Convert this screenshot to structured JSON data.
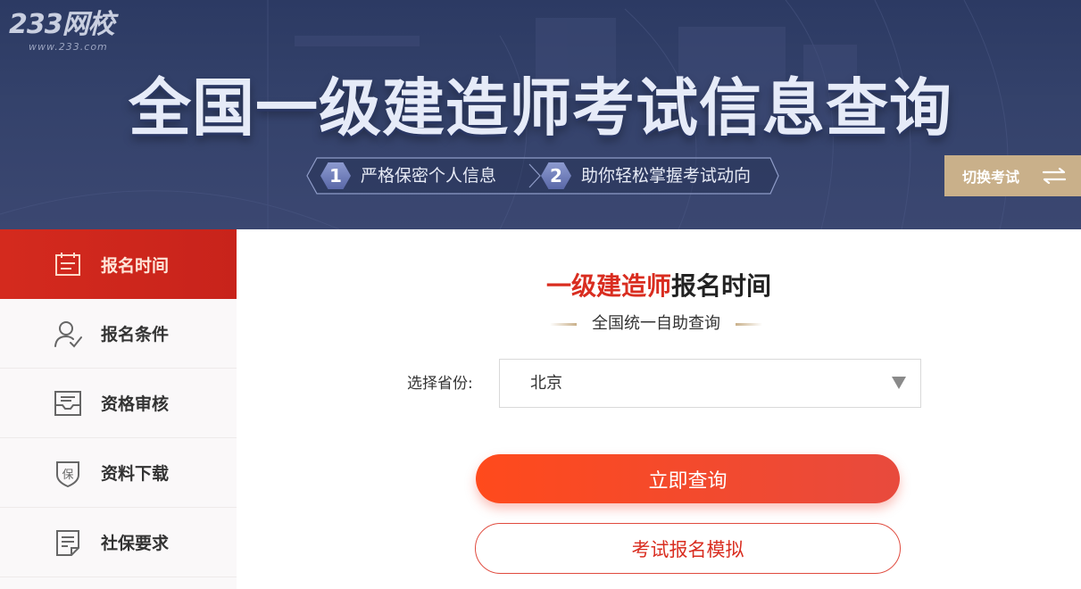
{
  "brand": {
    "logo_text": "233网校",
    "logo_url_text": "www.233.com"
  },
  "banner": {
    "title": "全国一级建造师考试信息查询",
    "tips": [
      {
        "num": "1",
        "text": "严格保密个人信息"
      },
      {
        "num": "2",
        "text": "助你轻松掌握考试动向"
      }
    ],
    "switch_label": "切换考试",
    "switch_icon": "swap-arrows-icon"
  },
  "sidebar": {
    "items": [
      {
        "label": "报名时间",
        "icon": "calendar-icon",
        "active": true
      },
      {
        "label": "报名条件",
        "icon": "user-check-icon",
        "active": false
      },
      {
        "label": "资格审核",
        "icon": "inbox-review-icon",
        "active": false
      },
      {
        "label": "资料下载",
        "icon": "shield-bao-icon",
        "active": false
      },
      {
        "label": "社保要求",
        "icon": "document-icon",
        "active": false
      }
    ]
  },
  "main": {
    "title_highlight": "一级建造师",
    "title_rest": "报名时间",
    "subtitle": "全国统一自助查询",
    "province_label": "选择省份:",
    "province_value": "北京",
    "query_button": "立即查询",
    "simulate_button": "考试报名模拟"
  },
  "colors": {
    "banner_bg": "#34426b",
    "accent_red": "#d92d20",
    "button_gradient_start": "#ff4a1c",
    "button_gradient_end": "#e84a3d",
    "gold": "#c9b08a",
    "sidebar_bg": "#faf8f9"
  }
}
